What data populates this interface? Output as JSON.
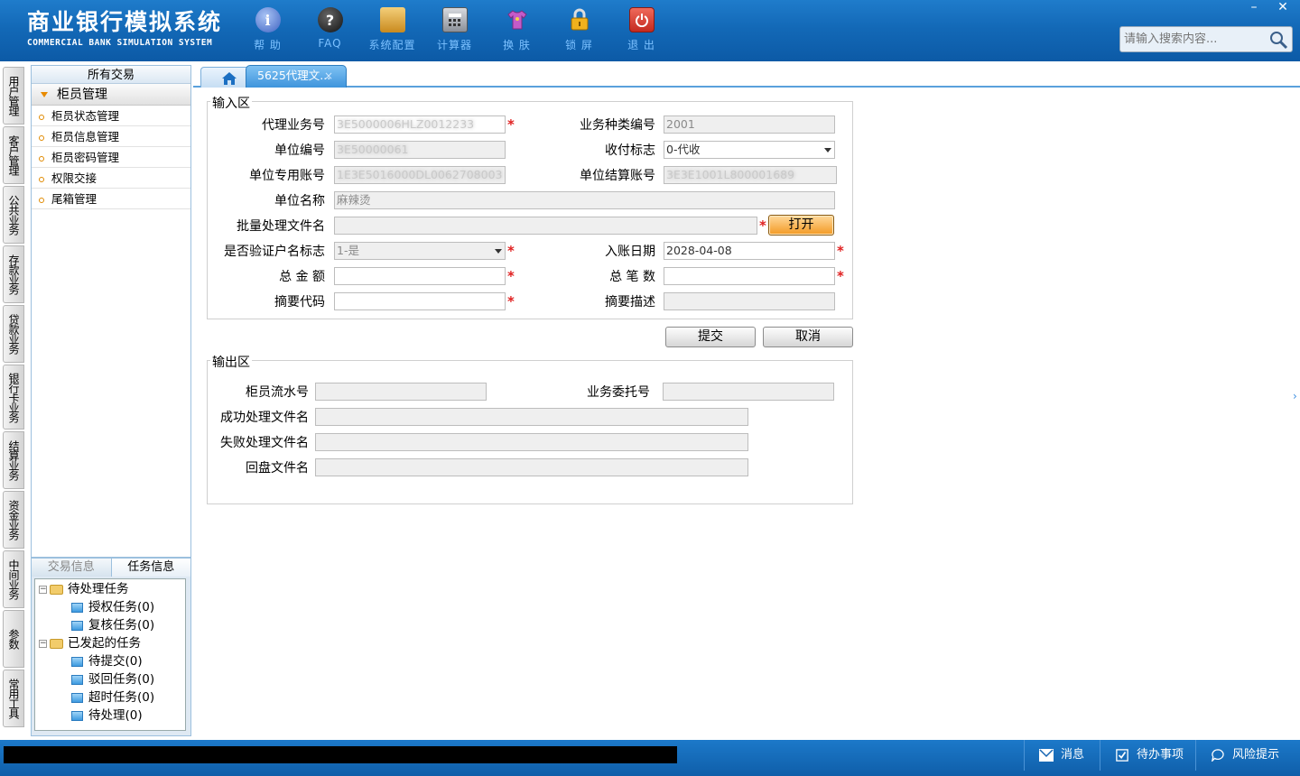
{
  "brand": {
    "title_cn": "商业银行模拟系统",
    "title_en": "COMMERCIAL BANK SIMULATION SYSTEM"
  },
  "toolbar": [
    {
      "label": "帮 助",
      "icon": "help-icon",
      "color": "#4f74c9",
      "glyph": "i"
    },
    {
      "label": "FAQ",
      "icon": "faq-icon",
      "color": "#2b2b2b",
      "glyph": "?"
    },
    {
      "label": "系统配置",
      "icon": "settings-box-icon",
      "color": "#d99a2e",
      "glyph": ""
    },
    {
      "label": "计算器",
      "icon": "calculator-icon",
      "color": "#8a8f99",
      "glyph": ""
    },
    {
      "label": "换 肤",
      "icon": "tshirt-icon",
      "color": "#b25ab8",
      "glyph": ""
    },
    {
      "label": "锁 屏",
      "icon": "lock-icon",
      "color": "#e2a81c",
      "glyph": ""
    },
    {
      "label": "退 出",
      "icon": "power-icon",
      "color": "#d33a2f",
      "glyph": ""
    }
  ],
  "window": {
    "minimize": "–",
    "close": "✕"
  },
  "search": {
    "placeholder": "请输入搜索内容..."
  },
  "vertical_tabs": [
    "用户管理",
    "客户管理",
    "公共业务",
    "存款业务",
    "贷款业务",
    "银行卡业务",
    "结算业务",
    "资金业务",
    "中间业务",
    "参数",
    "常用工具"
  ],
  "nav": {
    "header": "所有交易",
    "group": "柜员管理",
    "items": [
      "柜员状态管理",
      "柜员信息管理",
      "柜员密码管理",
      "权限交接",
      "尾箱管理"
    ]
  },
  "task_panel": {
    "tab_trade": "交易信息",
    "tab_task": "任务信息",
    "tree": {
      "pending": "待处理任务",
      "auth": "授权任务(0)",
      "review": "复核任务(0)",
      "initiated": "已发起的任务",
      "to_submit": "待提交(0)",
      "rejected": "驳回任务(0)",
      "timeout": "超时任务(0)",
      "to_process": "待处理(0)"
    }
  },
  "tabs": {
    "doc_tab": "5625代理文...",
    "close": "×"
  },
  "input_area": {
    "legend": "输入区",
    "agent_no_label": "代理业务号",
    "agent_no_value": "3E5000006HLZ0012233",
    "biz_type_label": "业务种类编号",
    "biz_type_value": "2001",
    "unit_no_label": "单位编号",
    "unit_no_value": "3E50000061",
    "pay_flag_label": "收付标志",
    "pay_flag_value": "0-代收",
    "unit_acct_label": "单位专用账号",
    "unit_acct_value": "1E3E5016000DL0062708003",
    "settle_acct_label": "单位结算账号",
    "settle_acct_value": "3E3E1001L800001689",
    "unit_name_label": "单位名称",
    "unit_name_value": "麻辣烫",
    "batch_file_label": "批量处理文件名",
    "batch_file_value": "",
    "open_button": "打开",
    "verify_label": "是否验证户名标志",
    "verify_value": "1-是",
    "entry_date_label": "入账日期",
    "entry_date_value": "2028-04-08",
    "total_amount_label": "总 金 额",
    "total_amount_value": "",
    "total_count_label": "总 笔 数",
    "total_count_value": "",
    "summary_code_label": "摘要代码",
    "summary_code_value": "",
    "summary_desc_label": "摘要描述",
    "summary_desc_value": ""
  },
  "actions": {
    "submit": "提交",
    "cancel": "取消"
  },
  "output_area": {
    "legend": "输出区",
    "teller_serial_label": "柜员流水号",
    "teller_serial_value": "",
    "entrust_no_label": "业务委托号",
    "entrust_no_value": "",
    "success_file_label": "成功处理文件名",
    "success_file_value": "",
    "fail_file_label": "失败处理文件名",
    "fail_file_value": "",
    "return_file_label": "回盘文件名",
    "return_file_value": ""
  },
  "required_mark": "*",
  "statusbar": {
    "message": "消息",
    "todo": "待办事项",
    "risk": "风险提示"
  }
}
